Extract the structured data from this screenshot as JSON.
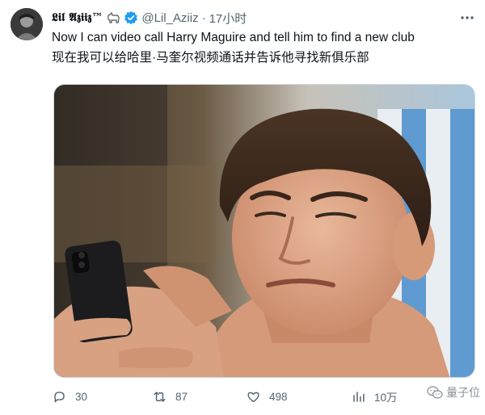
{
  "tweet": {
    "display_name": "𝕷𝖎𝖑 𝕬𝖟𝖎𝖎𝖟™",
    "handle": "@Lil_Aziiz",
    "separator": "·",
    "time": "17小时",
    "text_en": "Now I can video call Harry Maguire and tell him to find a new club",
    "text_zh": "现在我可以给哈里·马奎尔视频通话并告诉他寻找新俱乐部",
    "icons": {
      "avatar": "avatar",
      "name_emoji": "goat-emoji",
      "verified": "verified-badge-icon",
      "more": "more-options-icon"
    },
    "colors": {
      "verified": "#1d9bf0",
      "meta_text": "#536471",
      "text": "#0f1419"
    }
  },
  "actions": {
    "reply_count": "30",
    "retweet_count": "87",
    "like_count": "498",
    "views_count": "10万",
    "icons": [
      "reply-icon",
      "retweet-icon",
      "like-icon",
      "views-icon"
    ]
  },
  "watermark": {
    "text": "量子位",
    "icon": "wechat-icon"
  }
}
